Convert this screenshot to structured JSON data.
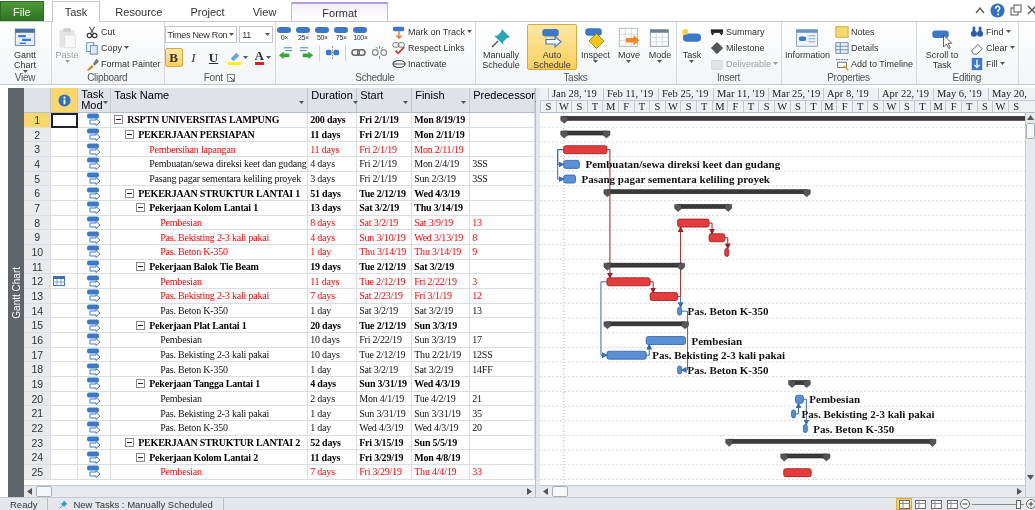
{
  "ribbon_tabs": [
    {
      "label": "File",
      "kind": "file",
      "selected": false
    },
    {
      "label": "Task",
      "kind": "normal",
      "selected": true
    },
    {
      "label": "Resource",
      "kind": "normal",
      "selected": false
    },
    {
      "label": "Project",
      "kind": "normal",
      "selected": false
    },
    {
      "label": "View",
      "kind": "normal",
      "selected": false
    },
    {
      "label": "Format",
      "kind": "contextual",
      "selected": false
    }
  ],
  "ribbon": {
    "groups": [
      {
        "label": "View",
        "launcher": false,
        "columns": [
          [
            [
              {
                "kind": "large",
                "label": "Gantt Chart",
                "dropdown": true,
                "disabled": false,
                "on": false
              }
            ]
          ]
        ]
      },
      {
        "label": "Clipboard",
        "launcher": false,
        "columns": [
          [
            [
              {
                "kind": "large",
                "label": "Paste",
                "dropdown": true,
                "disabled": true,
                "on": false
              }
            ]
          ],
          [
            [
              {
                "kind": "small",
                "label": "Cut",
                "disabled": false,
                "on": false
              }
            ],
            [
              {
                "kind": "small",
                "label": "Copy",
                "dropdown": true,
                "disabled": false,
                "on": false
              }
            ],
            [
              {
                "kind": "small",
                "label": "Format Painter",
                "disabled": false,
                "on": false
              }
            ]
          ]
        ]
      },
      {
        "label": "Font",
        "launcher": true,
        "columns": [
          [
            [
              {
                "kind": "field",
                "label": "Times New Ron",
                "dropdown": true,
                "disabled": false,
                "on": false
              },
              {
                "kind": "field",
                "label": "11",
                "dropdown": true,
                "disabled": false,
                "on": false
              }
            ],
            [
              {
                "kind": "toggle",
                "label": "B",
                "disabled": false,
                "on": true
              },
              {
                "kind": "toggle",
                "label": "I",
                "disabled": false,
                "on": false
              },
              {
                "kind": "toggle",
                "label": "U",
                "disabled": false,
                "on": false
              },
              {
                "kind": "icon",
                "dropdown": true,
                "disabled": false,
                "on": false
              },
              {
                "kind": "fontcolor",
                "label": "A",
                "dropdown": true,
                "disabled": false,
                "on": false
              }
            ]
          ]
        ]
      },
      {
        "label": "Schedule",
        "launcher": false,
        "columns": [
          [
            [
              {
                "kind": "percent",
                "label": "0×",
                "disabled": false,
                "on": false
              },
              {
                "kind": "percent",
                "label": "25×",
                "disabled": false,
                "on": false
              },
              {
                "kind": "percent",
                "label": "50×",
                "disabled": false,
                "on": false
              },
              {
                "kind": "percent",
                "label": "75×",
                "disabled": false,
                "on": false
              },
              {
                "kind": "percent",
                "label": "100×",
                "disabled": false,
                "on": false
              }
            ],
            [
              {
                "kind": "icon",
                "disabled": false,
                "on": false
              },
              {
                "kind": "icon",
                "disabled": false,
                "on": false
              },
              {
                "kind": "icon",
                "disabled": false,
                "on": false
              },
              {
                "kind": "icon",
                "disabled": false,
                "on": false
              },
              {
                "kind": "icon",
                "disabled": false,
                "on": false
              }
            ]
          ],
          [
            [
              {
                "kind": "small",
                "label": "Mark on Track",
                "dropdown": true,
                "disabled": false,
                "on": false
              }
            ],
            [
              {
                "kind": "small",
                "label": "Respect Links",
                "disabled": false,
                "on": false
              }
            ],
            [
              {
                "kind": "small",
                "label": "Inactivate",
                "disabled": false,
                "on": false
              }
            ]
          ]
        ]
      },
      {
        "label": "Tasks",
        "launcher": false,
        "columns": [
          [
            [
              {
                "kind": "large",
                "label": "Manually Schedule",
                "disabled": false,
                "on": false
              }
            ]
          ],
          [
            [
              {
                "kind": "large",
                "label": "Auto Schedule",
                "disabled": false,
                "on": true
              }
            ]
          ],
          [
            [
              {
                "kind": "large",
                "label": "Inspect",
                "dropdown": true,
                "disabled": false,
                "on": false
              }
            ]
          ],
          [
            [
              {
                "kind": "large",
                "label": "Move",
                "dropdown": true,
                "disabled": false,
                "on": false
              }
            ]
          ],
          [
            [
              {
                "kind": "large",
                "label": "Mode",
                "dropdown": true,
                "disabled": false,
                "on": false
              }
            ]
          ]
        ]
      },
      {
        "label": "Insert",
        "launcher": false,
        "columns": [
          [
            [
              {
                "kind": "large",
                "label": "Task",
                "dropdown": true,
                "disabled": false,
                "on": false
              }
            ]
          ],
          [
            [
              {
                "kind": "small",
                "label": "Summary",
                "disabled": false,
                "on": false
              }
            ],
            [
              {
                "kind": "small",
                "label": "Milestone",
                "disabled": false,
                "on": false
              }
            ],
            [
              {
                "kind": "small",
                "label": "Deliverable",
                "dropdown": true,
                "disabled": true,
                "on": false
              }
            ]
          ]
        ]
      },
      {
        "label": "Properties",
        "launcher": false,
        "columns": [
          [
            [
              {
                "kind": "large",
                "label": "Information",
                "disabled": false,
                "on": false
              }
            ]
          ],
          [
            [
              {
                "kind": "small",
                "label": "Notes",
                "disabled": false,
                "on": false
              }
            ],
            [
              {
                "kind": "small",
                "label": "Details",
                "disabled": false,
                "on": false
              }
            ],
            [
              {
                "kind": "small",
                "label": "Add to Timeline",
                "disabled": false,
                "on": false
              }
            ]
          ]
        ]
      },
      {
        "label": "Editing",
        "launcher": false,
        "columns": [
          [
            [
              {
                "kind": "large",
                "label": "Scroll to Task",
                "disabled": false,
                "on": false
              }
            ]
          ],
          [
            [
              {
                "kind": "small",
                "label": "Find",
                "dropdown": true,
                "disabled": false,
                "on": false
              }
            ],
            [
              {
                "kind": "small",
                "label": "Clear",
                "dropdown": true,
                "disabled": false,
                "on": false
              }
            ],
            [
              {
                "kind": "small",
                "label": "Fill",
                "dropdown": true,
                "disabled": false,
                "on": false
              }
            ]
          ]
        ]
      }
    ]
  },
  "view_bar": {
    "label": "Gantt Chart"
  },
  "sheet": {
    "columns": [
      "Task Mod",
      "Task Name",
      "Duration",
      "Start",
      "Finish",
      "Predecessor"
    ]
  },
  "timescale": {
    "major": [
      "Jan 28, '19",
      "Feb 11, '19",
      "Feb 25, '19",
      "Mar 11, '19",
      "Mar 25, '19",
      "Apr 8, '19",
      "Apr 22, '19",
      "May 6, '19",
      "May 20,"
    ],
    "minor": [
      "S",
      "W",
      "S",
      "T",
      "M",
      "F",
      "T",
      "S",
      "W",
      "S",
      "T",
      "M",
      "F",
      "T",
      "S",
      "W",
      "S",
      "T",
      "M",
      "F",
      "T",
      "S",
      "W",
      "S",
      "T",
      "M",
      "F",
      "T",
      "S",
      "W",
      "S"
    ]
  },
  "tasks": [
    {
      "id": "1",
      "name": "RSPTN UNIVERSITAS LAMPUNG",
      "duration": "200 days",
      "start": "Fri 2/1/19",
      "finish": "Mon 8/19/19",
      "kind": "summary",
      "expanded": true,
      "selected": true,
      "children": [
        {
          "id": "2",
          "name": "PEKERJAAN PERSIAPAN",
          "duration": "11 days",
          "start": "Fri 2/1/19",
          "finish": "Mon 2/11/19",
          "kind": "summary",
          "expanded": true,
          "selected": false,
          "children": [
            {
              "id": "3",
              "name": "Pembersihan lapangan",
              "duration": "11 days",
              "start": "Fri 2/1/19",
              "finish": "Mon 2/11/19",
              "kind": "critical",
              "selected": false
            },
            {
              "id": "4",
              "name": "Pembuatan/sewa direksi keet dan gudang",
              "duration": "4 days",
              "start": "Fri 2/1/19",
              "finish": "Mon 2/4/19",
              "predecessors": "3SS",
              "kind": "task",
              "selected": false,
              "bar_label": "Pembuatan/sewa direksi keet dan gudang"
            },
            {
              "id": "5",
              "name": "Pasang pagar sementara keliling proyek",
              "duration": "3 days",
              "start": "Fri 2/1/19",
              "finish": "Sun 2/3/19",
              "predecessors": "3SS",
              "kind": "task",
              "selected": false,
              "bar_label": "Pasang pagar sementara keliling proyek"
            }
          ]
        },
        {
          "id": "6",
          "name": "PEKERJAAN STRUKTUR LANTAI 1",
          "duration": "51 days",
          "start": "Tue 2/12/19",
          "finish": "Wed 4/3/19",
          "kind": "summary",
          "expanded": true,
          "selected": false,
          "children": [
            {
              "id": "7",
              "name": "Pekerjaan Kolom Lantai 1",
              "duration": "13 days",
              "start": "Sat 3/2/19",
              "finish": "Thu 3/14/19",
              "kind": "summary",
              "expanded": true,
              "selected": false,
              "children": [
                {
                  "id": "8",
                  "name": "Pembesian",
                  "duration": "8 days",
                  "start": "Sat 3/2/19",
                  "finish": "Sat 3/9/19",
                  "predecessors": "13",
                  "kind": "critical",
                  "selected": false
                },
                {
                  "id": "9",
                  "name": "Pas. Bekisting 2-3 kali pakai",
                  "duration": "4 days",
                  "start": "Sun 3/10/19",
                  "finish": "Wed 3/13/19",
                  "predecessors": "8",
                  "kind": "critical",
                  "selected": false
                },
                {
                  "id": "10",
                  "name": "Pas. Beton K-350",
                  "duration": "1 day",
                  "start": "Thu 3/14/19",
                  "finish": "Thu 3/14/19",
                  "predecessors": "9",
                  "kind": "critical",
                  "selected": false
                }
              ]
            },
            {
              "id": "11",
              "name": "Pekerjaan Balok Tie Beam",
              "duration": "19 days",
              "start": "Tue 2/12/19",
              "finish": "Sat 3/2/19",
              "kind": "summary",
              "expanded": true,
              "selected": false,
              "children": [
                {
                  "id": "12",
                  "name": "Pembesian",
                  "duration": "11 days",
                  "start": "Tue 2/12/19",
                  "finish": "Fri 2/22/19",
                  "predecessors": "3",
                  "kind": "critical",
                  "selected": false,
                  "calendar_indicator": true
                },
                {
                  "id": "13",
                  "name": "Pas. Bekisting 2-3 kali pakai",
                  "duration": "7 days",
                  "start": "Sat 2/23/19",
                  "finish": "Fri 3/1/19",
                  "predecessors": "12",
                  "kind": "critical",
                  "selected": false
                },
                {
                  "id": "14",
                  "name": "Pas. Beton K-350",
                  "duration": "1 day",
                  "start": "Sat 3/2/19",
                  "finish": "Sat 3/2/19",
                  "predecessors": "13",
                  "kind": "task",
                  "selected": false,
                  "bar_label": "Pas. Beton K-350"
                }
              ]
            },
            {
              "id": "15",
              "name": "Pekerjaan Plat Lantai 1",
              "duration": "20 days",
              "start": "Tue 2/12/19",
              "finish": "Sun 3/3/19",
              "kind": "summary",
              "expanded": true,
              "selected": false,
              "children": [
                {
                  "id": "16",
                  "name": "Pembesian",
                  "duration": "10 days",
                  "start": "Fri 2/22/19",
                  "finish": "Sun 3/3/19",
                  "predecessors": "17",
                  "kind": "task",
                  "selected": false,
                  "bar_label": "Pembesian"
                },
                {
                  "id": "17",
                  "name": "Pas. Bekisting 2-3 kali pakai",
                  "duration": "10 days",
                  "start": "Tue 2/12/19",
                  "finish": "Thu 2/21/19",
                  "predecessors": "12SS",
                  "kind": "task",
                  "selected": false,
                  "bar_label": "Pas. Bekisting 2-3 kali pakai"
                },
                {
                  "id": "18",
                  "name": "Pas. Beton K-350",
                  "duration": "1 day",
                  "start": "Sat 3/2/19",
                  "finish": "Sat 3/2/19",
                  "predecessors": "14FF",
                  "kind": "task",
                  "selected": false,
                  "bar_label": "Pas. Beton K-350"
                }
              ]
            },
            {
              "id": "19",
              "name": "Pekerjaan Tangga Lantai 1",
              "duration": "4 days",
              "start": "Sun 3/31/19",
              "finish": "Wed 4/3/19",
              "kind": "summary",
              "expanded": true,
              "selected": false,
              "children": [
                {
                  "id": "20",
                  "name": "Pembesian",
                  "duration": "2 days",
                  "start": "Mon 4/1/19",
                  "finish": "Tue 4/2/19",
                  "predecessors": "21",
                  "kind": "task",
                  "selected": false,
                  "bar_label": "Pembesian"
                },
                {
                  "id": "21",
                  "name": "Pas. Bekisting 2-3 kali pakai",
                  "duration": "1 day",
                  "start": "Sun 3/31/19",
                  "finish": "Sun 3/31/19",
                  "predecessors": "35",
                  "kind": "task",
                  "selected": false,
                  "bar_label": "Pas. Bekisting 2-3 kali pakai"
                },
                {
                  "id": "22",
                  "name": "Pas. Beton K-350",
                  "duration": "1 day",
                  "start": "Wed 4/3/19",
                  "finish": "Wed 4/3/19",
                  "predecessors": "20",
                  "kind": "task",
                  "selected": false,
                  "bar_label": "Pas. Beton K-350"
                }
              ]
            }
          ]
        },
        {
          "id": "23",
          "name": "PEKERJAAN STRUKTUR LANTAI 2",
          "duration": "52 days",
          "start": "Fri 3/15/19",
          "finish": "Sun 5/5/19",
          "kind": "summary",
          "expanded": true,
          "selected": false,
          "children": [
            {
              "id": "24",
              "name": "Pekerjaan Kolom Lantai 2",
              "duration": "11 days",
              "start": "Fri 3/29/19",
              "finish": "Mon 4/8/19",
              "kind": "summary",
              "expanded": true,
              "selected": false,
              "children": [
                {
                  "id": "25",
                  "name": "Pembesian",
                  "duration": "7 days",
                  "start": "Fri 3/29/19",
                  "finish": "Thu 4/4/19",
                  "predecessors": "33",
                  "kind": "critical",
                  "selected": false
                }
              ]
            }
          ]
        }
      ]
    }
  ],
  "status_bar": {
    "items": [
      "Ready",
      "New Tasks : Manually Scheduled"
    ],
    "view_buttons": [
      {
        "selected": true
      },
      {
        "selected": false
      },
      {
        "selected": false
      },
      {
        "selected": false
      }
    ],
    "zoom_slider": {
      "level": 0.88
    }
  }
}
